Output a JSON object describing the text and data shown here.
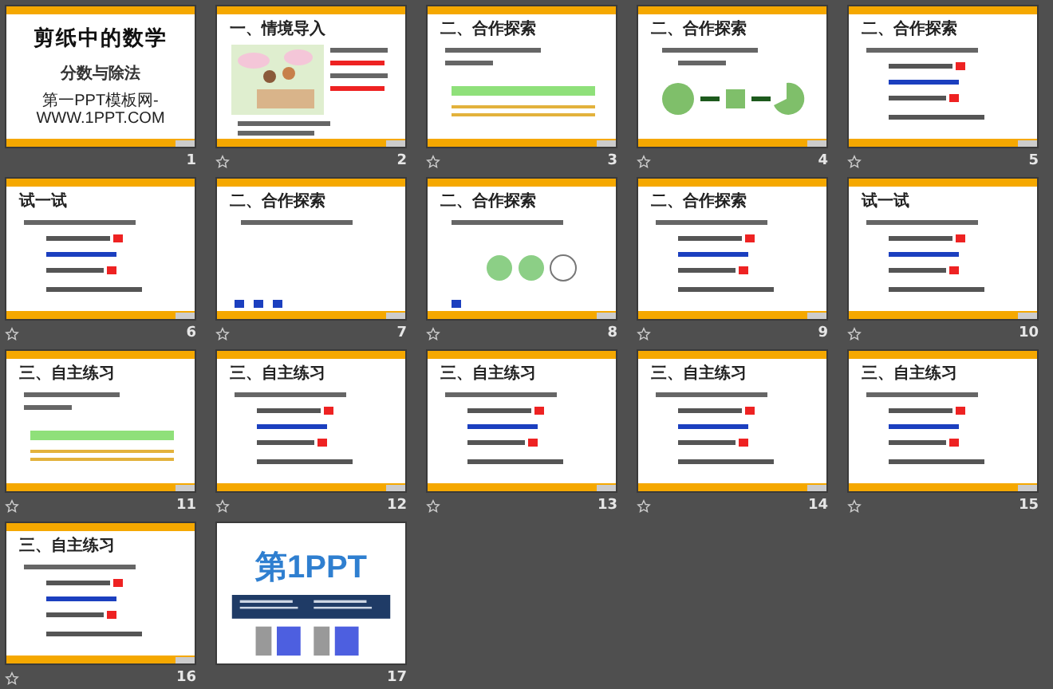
{
  "slides": [
    {
      "number": "1",
      "kind": "cover",
      "title": "剪纸中的数学",
      "subtitle": "分数与除法",
      "footer": "第一PPT模板网-WWW.1PPT.COM",
      "animated": false
    },
    {
      "number": "2",
      "kind": "illustration",
      "title": "一、情境导入",
      "animated": true
    },
    {
      "number": "3",
      "kind": "bar",
      "title": "二、合作探索",
      "animated": true
    },
    {
      "number": "4",
      "kind": "pieces",
      "title": "二、合作探索",
      "animated": true
    },
    {
      "number": "5",
      "kind": "text",
      "title": "二、合作探索",
      "animated": true
    },
    {
      "number": "6",
      "kind": "text",
      "title": "试一试",
      "animated": true
    },
    {
      "number": "7",
      "kind": "dots",
      "title": "二、合作探索",
      "animated": true
    },
    {
      "number": "8",
      "kind": "circles",
      "title": "二、合作探索",
      "animated": true
    },
    {
      "number": "9",
      "kind": "text",
      "title": "二、合作探索",
      "animated": true
    },
    {
      "number": "10",
      "kind": "text",
      "title": "试一试",
      "animated": true
    },
    {
      "number": "11",
      "kind": "bar",
      "title": "三、自主练习",
      "animated": true
    },
    {
      "number": "12",
      "kind": "text",
      "title": "三、自主练习",
      "animated": true
    },
    {
      "number": "13",
      "kind": "text",
      "title": "三、自主练习",
      "animated": true
    },
    {
      "number": "14",
      "kind": "text",
      "title": "三、自主练习",
      "animated": true
    },
    {
      "number": "15",
      "kind": "text",
      "title": "三、自主练习",
      "animated": true
    },
    {
      "number": "16",
      "kind": "text",
      "title": "三、自主练习",
      "animated": true
    },
    {
      "number": "17",
      "kind": "logo",
      "title": "第1PPT",
      "animated": false
    }
  ]
}
